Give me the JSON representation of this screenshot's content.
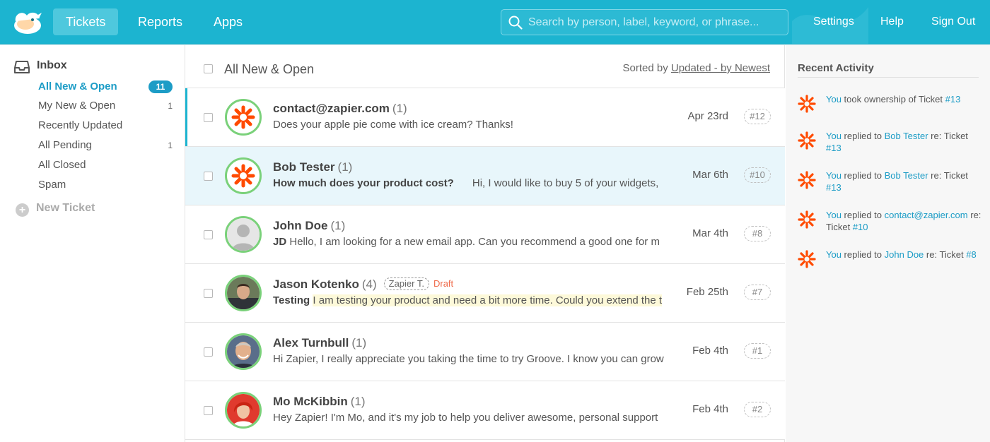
{
  "header": {
    "nav": [
      "Tickets",
      "Reports",
      "Apps"
    ],
    "search_placeholder": "Search by person, label, keyword, or phrase...",
    "links": [
      "Settings",
      "Help",
      "Sign Out"
    ],
    "colors": {
      "bar": "#1cb4d0",
      "active_tab": "#4ec8dd"
    }
  },
  "sidebar": {
    "heading": "Inbox",
    "items": [
      {
        "label": "All New & Open",
        "badge": "11"
      },
      {
        "label": "My New & Open",
        "count": "1"
      },
      {
        "label": "Recently Updated"
      },
      {
        "label": "All Pending",
        "count": "1"
      },
      {
        "label": "All Closed"
      },
      {
        "label": "Spam"
      }
    ],
    "new_ticket": "New Ticket"
  },
  "list": {
    "title": "All New & Open",
    "sorted_prefix": "Sorted by",
    "sorted_link": "Updated - by Newest",
    "rows": [
      {
        "sender": "contact@zapier.com",
        "count": "(1)",
        "subject": "",
        "snippet": "Does your apple pie come with ice cream? Thanks!",
        "date": "Apr 23rd",
        "number": "#12",
        "avatar": "zapier-icon"
      },
      {
        "sender": "Bob Tester",
        "count": "(1)",
        "subject": "How much does your product cost?",
        "snippet": "Hi, I would like to buy 5 of your widgets,",
        "date": "Mar 6th",
        "number": "#10",
        "avatar": "zapier-icon"
      },
      {
        "sender": "John Doe",
        "count": "(1)",
        "subject": "JD",
        "snippet": "Hello, I am looking for a new email app. Can you recommend a good one for m",
        "date": "Mar 4th",
        "number": "#8",
        "avatar": "default-user-icon"
      },
      {
        "sender": "Jason Kotenko",
        "count": "(4)",
        "tag": "Zapier T.",
        "draft": "Draft",
        "subject": "Testing",
        "snippet": "I am testing your product and need a bit more time. Could you extend the t",
        "date": "Feb 25th",
        "number": "#7",
        "avatar": "photo"
      },
      {
        "sender": "Alex Turnbull",
        "count": "(1)",
        "subject": "",
        "snippet": "Hi Zapier, I really appreciate you taking the time to try Groove. I know you can grow",
        "date": "Feb 4th",
        "number": "#1",
        "avatar": "photo"
      },
      {
        "sender": "Mo McKibbin",
        "count": "(1)",
        "subject": "",
        "snippet": "Hey Zapier! I'm Mo, and it's my job to help you deliver awesome, personal support",
        "date": "Feb 4th",
        "number": "#2",
        "avatar": "photo"
      }
    ]
  },
  "activity": {
    "title": "Recent Activity",
    "items": [
      {
        "actor": "You",
        "text1": " took ownership of Ticket ",
        "link1": "#13",
        "text2": "",
        "link2": ""
      },
      {
        "actor": "You",
        "text1": " replied to ",
        "link1": "Bob Tester",
        "text2": " re: Ticket ",
        "link2": "#13"
      },
      {
        "actor": "You",
        "text1": " replied to ",
        "link1": "Bob Tester",
        "text2": " re: Ticket ",
        "link2": "#13"
      },
      {
        "actor": "You",
        "text1": " replied to ",
        "link1": "contact@zapier.com",
        "text2": " re: Ticket ",
        "link2": "#10"
      },
      {
        "actor": "You",
        "text1": " replied to ",
        "link1": "John Doe",
        "text2": " re: Ticket ",
        "link2": "#8"
      }
    ]
  }
}
